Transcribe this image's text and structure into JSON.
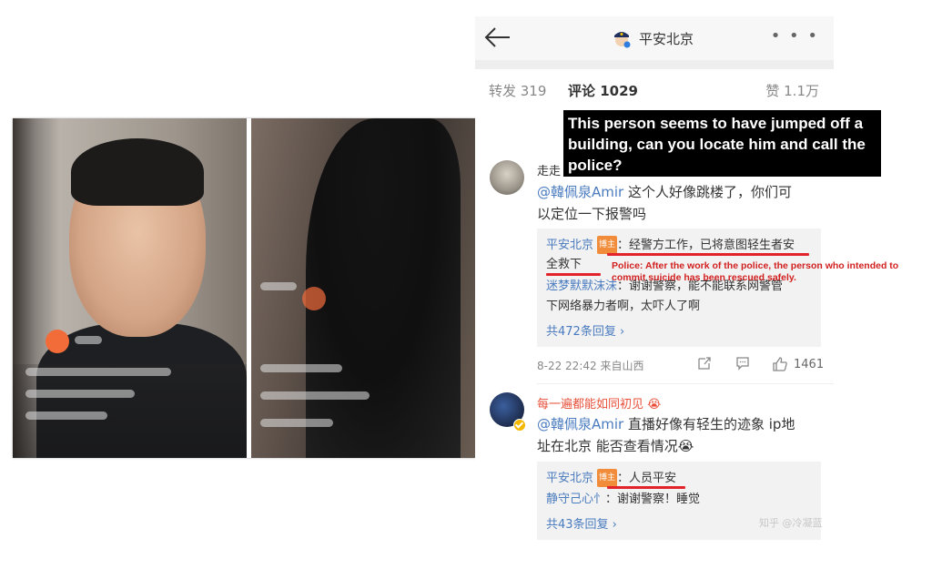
{
  "header": {
    "title": "平安北京",
    "back_icon": "back-arrow-icon",
    "more_icon": "more-dots-icon",
    "more_glyph": "• • •"
  },
  "tabs": {
    "repost": "转发 319",
    "comment": "评论 1029",
    "like": "赞 1.1万"
  },
  "comment1": {
    "username": "走走",
    "mention": "@韓佩泉Amir",
    "text_line1": " 这个人好像跳楼了，你们可",
    "text_line2": "以定位一下报警吗",
    "replies": {
      "author": "平安北京",
      "author_tag": "博主",
      "reply1_line1": "：经警方工作，已将意图轻生者安",
      "reply1_line2": "全救下",
      "reply2_author": "迷梦默默沫沫",
      "reply2_line1": "：谢谢警察，能不能联系网警管",
      "reply2_line2": "下网络暴力者啊，太吓人了啊",
      "more": "共472条回复 ›"
    },
    "meta": {
      "time_location": "8-22 22:42  来自山西",
      "like_count": "1461"
    }
  },
  "comment2": {
    "username": "每一遍都能如同初见",
    "emoji": "😭",
    "mention": "@韓佩泉Amir",
    "text_line1": " 直播好像有轻生的迹象 ip地",
    "text_line2": "址在北京 能否查看情况",
    "text_emoji": "😭",
    "replies": {
      "author": "平安北京",
      "author_tag": "博主",
      "reply1": "：人员平安",
      "reply2_author": "静守己心忄",
      "reply2": "：谢谢警察！睡觉",
      "more": "共43条回复 ›"
    }
  },
  "watermark": "知乎 @冷凝蓝",
  "annotations": {
    "translation": "This person seems to have jumped off a building, can you locate him and call the police?",
    "police_translation": "Police: After the work of the police, the person who intended to commit suicide has been rescued safely."
  },
  "colors": {
    "username_orange": "#e8503a",
    "link_blue": "#4a7bbf",
    "underline_red": "#e2232a",
    "annotation_red": "#d21f1f",
    "tag_orange": "#f08c3a"
  }
}
